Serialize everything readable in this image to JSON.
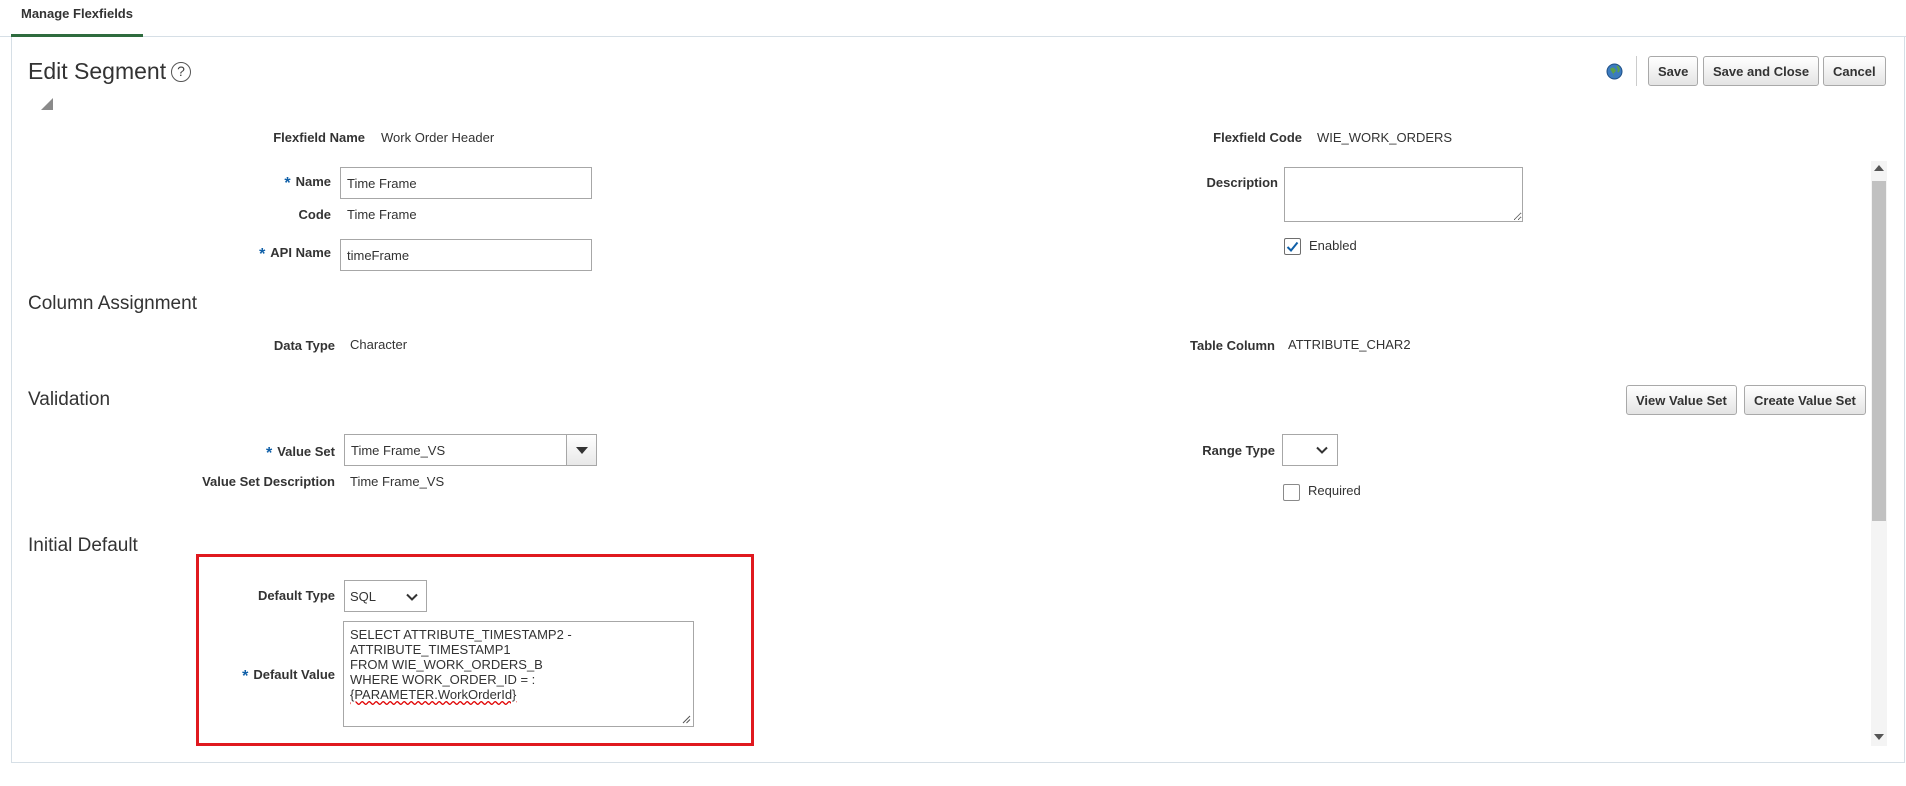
{
  "tabs": [
    {
      "label": "Manage Flexfields",
      "active": true
    }
  ],
  "page": {
    "title": "Edit Segment"
  },
  "toolbar": {
    "save_label": "Save",
    "save_close_label": "Save and Close",
    "cancel_label": "Cancel"
  },
  "header": {
    "flexfield_name_label": "Flexfield Name",
    "flexfield_name": "Work Order Header",
    "flexfield_code_label": "Flexfield Code",
    "flexfield_code": "WIE_WORK_ORDERS"
  },
  "form": {
    "name_label": "Name",
    "name_value": "Time Frame",
    "code_label": "Code",
    "code_value": "Time Frame",
    "api_name_label": "API Name",
    "api_name_value": "timeFrame",
    "description_label": "Description",
    "description_value": "",
    "enabled_label": "Enabled",
    "enabled": true
  },
  "column_assignment": {
    "heading": "Column Assignment",
    "data_type_label": "Data Type",
    "data_type": "Character",
    "table_column_label": "Table Column",
    "table_column": "ATTRIBUTE_CHAR2"
  },
  "validation": {
    "heading": "Validation",
    "view_value_set_label": "View Value Set",
    "create_value_set_label": "Create Value Set",
    "value_set_label": "Value Set",
    "value_set": "Time Frame_VS",
    "value_set_description_label": "Value Set Description",
    "value_set_description": "Time Frame_VS",
    "range_type_label": "Range Type",
    "range_type": "",
    "required_label": "Required",
    "required": false
  },
  "initial_default": {
    "heading": "Initial Default",
    "default_type_label": "Default Type",
    "default_type": "SQL",
    "default_value_label": "Default Value",
    "default_value_lines": [
      "SELECT ATTRIBUTE_TIMESTAMP2 -",
      "ATTRIBUTE_TIMESTAMP1",
      "FROM WIE_WORK_ORDERS_B",
      "WHERE WORK_ORDER_ID = :",
      "{PARAMETER.WorkOrderId}"
    ]
  },
  "colors": {
    "required_asterisk": "#0f5fa8",
    "highlight": "#e0191f",
    "tab_underline": "#2e6b3e"
  },
  "icons": {
    "help": "help-icon",
    "globe": "globe-icon",
    "collapse": "collapse-icon",
    "check": "check-icon",
    "dropdown": "chevron-down-icon"
  }
}
